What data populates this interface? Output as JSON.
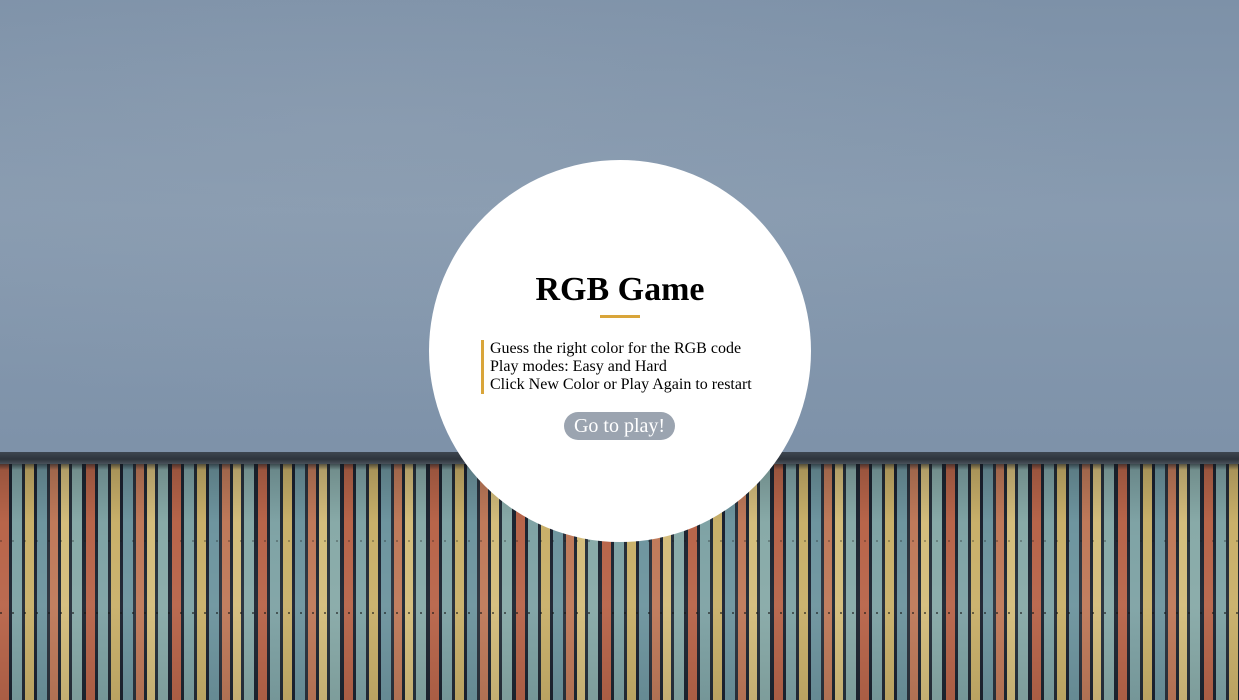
{
  "intro": {
    "title": "RGB Game",
    "rules": [
      "Guess the right color for the RGB code",
      "Play modes: Easy and Hard",
      "Click New Color or Play Again to restart"
    ],
    "play_button_label": "Go to play!"
  },
  "colors": {
    "accent": "#d9a53a",
    "button_bg": "#9ba4b0",
    "card_bg": "#ffffff",
    "sky": "#889bb0"
  }
}
